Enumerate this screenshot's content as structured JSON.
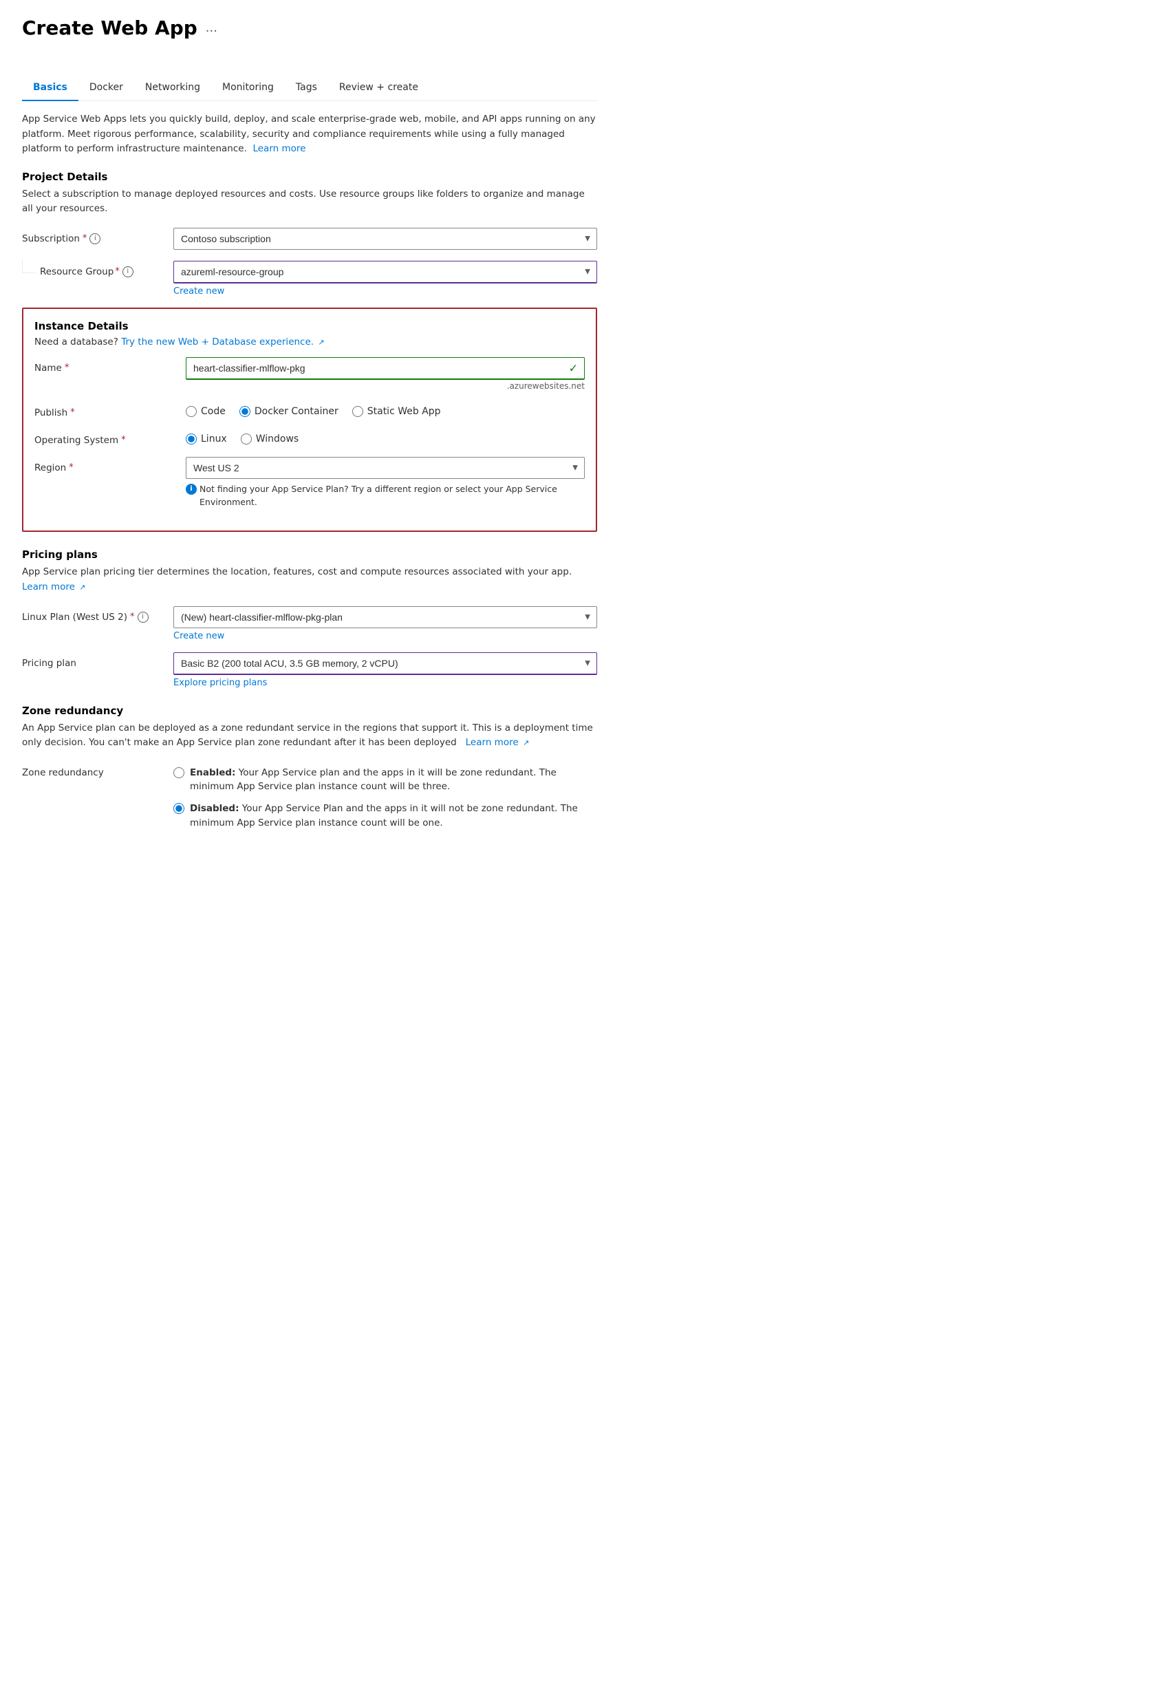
{
  "page": {
    "title": "Create Web App",
    "title_ellipsis": "..."
  },
  "tabs": [
    {
      "id": "basics",
      "label": "Basics",
      "active": true
    },
    {
      "id": "docker",
      "label": "Docker",
      "active": false
    },
    {
      "id": "networking",
      "label": "Networking",
      "active": false
    },
    {
      "id": "monitoring",
      "label": "Monitoring",
      "active": false
    },
    {
      "id": "tags",
      "label": "Tags",
      "active": false
    },
    {
      "id": "review",
      "label": "Review + create",
      "active": false
    }
  ],
  "description": "App Service Web Apps lets you quickly build, deploy, and scale enterprise-grade web, mobile, and API apps running on any platform. Meet rigorous performance, scalability, security and compliance requirements while using a fully managed platform to perform infrastructure maintenance.",
  "learn_more_link": "Learn more",
  "project_details": {
    "title": "Project Details",
    "description": "Select a subscription to manage deployed resources and costs. Use resource groups like folders to organize and manage all your resources.",
    "subscription_label": "Subscription",
    "subscription_value": "Contoso subscription",
    "resource_group_label": "Resource Group",
    "resource_group_value": "azureml-resource-group",
    "create_new": "Create new"
  },
  "instance_details": {
    "title": "Instance Details",
    "db_text": "Need a database?",
    "db_link": "Try the new Web + Database experience.",
    "name_label": "Name",
    "name_value": "heart-classifier-mlflow-pkg",
    "name_suffix": ".azurewebsites.net",
    "publish_label": "Publish",
    "publish_options": [
      {
        "id": "code",
        "label": "Code",
        "checked": false
      },
      {
        "id": "docker",
        "label": "Docker Container",
        "checked": true
      },
      {
        "id": "static",
        "label": "Static Web App",
        "checked": false
      }
    ],
    "os_label": "Operating System",
    "os_options": [
      {
        "id": "linux",
        "label": "Linux",
        "checked": true
      },
      {
        "id": "windows",
        "label": "Windows",
        "checked": false
      }
    ],
    "region_label": "Region",
    "region_value": "West US 2",
    "region_info": "Not finding your App Service Plan? Try a different region or select your App Service Environment."
  },
  "pricing_plans": {
    "title": "Pricing plans",
    "description": "App Service plan pricing tier determines the location, features, cost and compute resources associated with your app.",
    "learn_more": "Learn more",
    "linux_plan_label": "Linux Plan (West US 2)",
    "linux_plan_value": "(New) heart-classifier-mlflow-pkg-plan",
    "create_new": "Create new",
    "pricing_plan_label": "Pricing plan",
    "pricing_plan_value": "Basic B2 (200 total ACU, 3.5 GB memory, 2 vCPU)",
    "explore_link": "Explore pricing plans"
  },
  "zone_redundancy": {
    "title": "Zone redundancy",
    "description": "An App Service plan can be deployed as a zone redundant service in the regions that support it. This is a deployment time only decision. You can't make an App Service plan zone redundant after it has been deployed",
    "learn_more": "Learn more",
    "label": "Zone redundancy",
    "options": [
      {
        "id": "enabled",
        "label_bold": "Enabled:",
        "label_text": "Your App Service plan and the apps in it will be zone redundant. The minimum App Service plan instance count will be three.",
        "checked": false
      },
      {
        "id": "disabled",
        "label_bold": "Disabled:",
        "label_text": "Your App Service Plan and the apps in it will not be zone redundant. The minimum App Service plan instance count will be one.",
        "checked": true
      }
    ]
  }
}
